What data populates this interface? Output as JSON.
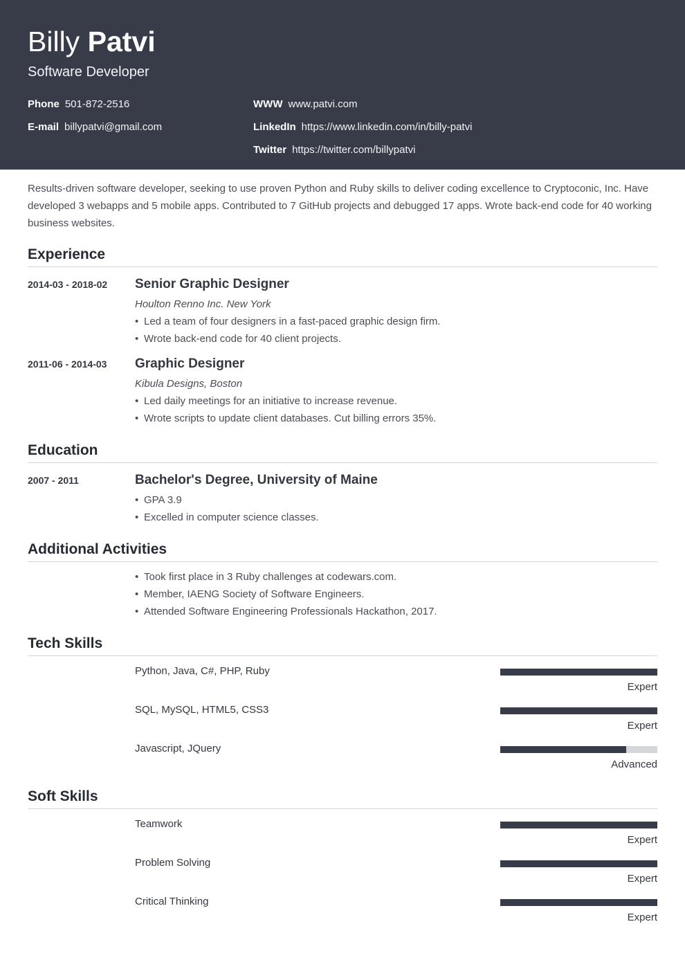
{
  "header": {
    "first_name": "Billy",
    "last_name": "Patvi",
    "title": "Software Developer",
    "contacts_left": [
      {
        "label": "Phone",
        "value": "501-872-2516"
      },
      {
        "label": "E-mail",
        "value": "billypatvi@gmail.com"
      }
    ],
    "contacts_right": [
      {
        "label": "WWW",
        "value": "www.patvi.com"
      },
      {
        "label": "LinkedIn",
        "value": "https://www.linkedin.com/in/billy-patvi"
      },
      {
        "label": "Twitter",
        "value": "https://twitter.com/billypatvi"
      }
    ],
    "background_color": "#373c48"
  },
  "summary": "Results-driven software developer, seeking to use proven Python and Ruby skills to deliver coding excellence to Cryptoconic, Inc. Have developed 3 webapps and 5 mobile apps. Contributed to 7 GitHub projects and debugged 17 apps. Wrote back-end code for 40 working business websites.",
  "experience": {
    "title": "Experience",
    "items": [
      {
        "dates": "2014-03 - 2018-02",
        "role": "Senior Graphic Designer",
        "company": "Houlton Renno Inc. New York",
        "bullets": [
          "Led a team of four designers in a fast-paced graphic design firm.",
          "Wrote back-end code for 40 client projects."
        ]
      },
      {
        "dates": "2011-06 - 2014-03",
        "role": "Graphic Designer",
        "company": "Kibula Designs, Boston",
        "bullets": [
          "Led daily meetings for an initiative to increase revenue.",
          "Wrote scripts to update client databases. Cut billing errors 35%."
        ]
      }
    ]
  },
  "education": {
    "title": "Education",
    "items": [
      {
        "dates": "2007 - 2011",
        "degree": "Bachelor's Degree, University of Maine",
        "bullets": [
          "GPA 3.9",
          "Excelled in computer science classes."
        ]
      }
    ]
  },
  "activities": {
    "title": "Additional Activities",
    "bullets": [
      "Took first place in 3 Ruby challenges at codewars.com.",
      "Member, IAENG Society of Software Engineers.",
      "Attended Software Engineering Professionals Hackathon, 2017."
    ]
  },
  "tech_skills": {
    "title": "Tech Skills",
    "items": [
      {
        "name": "Python, Java, C#, PHP, Ruby",
        "level": "Expert",
        "fraction": 1.0
      },
      {
        "name": "SQL, MySQL, HTML5, CSS3",
        "level": "Expert",
        "fraction": 1.0
      },
      {
        "name": "Javascript, JQuery",
        "level": "Advanced",
        "fraction": 0.8
      }
    ]
  },
  "soft_skills": {
    "title": "Soft Skills",
    "items": [
      {
        "name": "Teamwork",
        "level": "Expert",
        "fraction": 1.0
      },
      {
        "name": "Problem Solving",
        "level": "Expert",
        "fraction": 1.0
      },
      {
        "name": "Critical Thinking",
        "level": "Expert",
        "fraction": 1.0
      }
    ]
  },
  "bullet_glyph": "•"
}
